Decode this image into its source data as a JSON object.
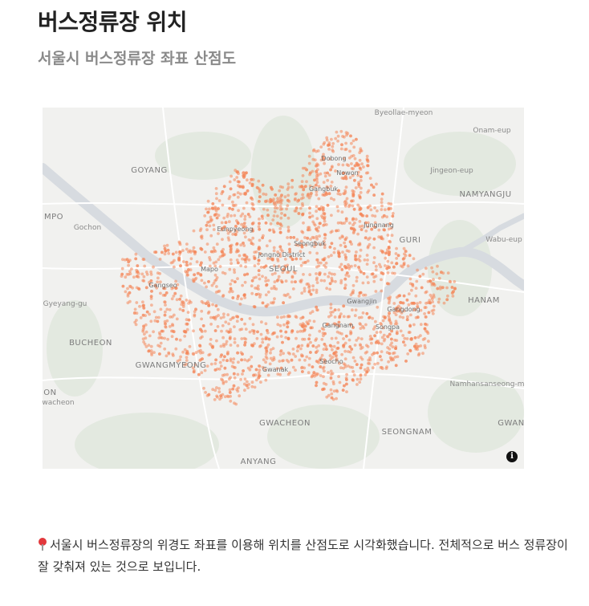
{
  "page": {
    "title": "버스정류장 위치",
    "subtitle": "서울시 버스정류장 좌표 산점도",
    "note": "서울시 버스정류장의 위경도 좌표를 이용해 위치를 산점도로 시각화했습니다. 전체적으로 버스 정류장이 잘 갖춰져 있는 것으로 보입니다.",
    "note_icon": "round-pushpin-icon"
  },
  "map": {
    "point_color": "#f4875a",
    "river_color": "#d9dde2",
    "land_color": "#f1f1ef",
    "info_label": "i",
    "place_labels": [
      {
        "name": "Byeollae-myeon"
      },
      {
        "name": "Onam-eup"
      },
      {
        "name": "GOYANG"
      },
      {
        "name": "Jingeon-eup"
      },
      {
        "name": "NAMYANGJU"
      },
      {
        "name": "MPO"
      },
      {
        "name": "Gochon"
      },
      {
        "name": "GURI"
      },
      {
        "name": "Wabu-eup"
      },
      {
        "name": "Gyeyang-gu"
      },
      {
        "name": "HANAM"
      },
      {
        "name": "BUCHEON"
      },
      {
        "name": "GWANGMYEONG"
      },
      {
        "name": "Namhansanseong-myeon"
      },
      {
        "name": "EON"
      },
      {
        "name": "Gwacheon"
      },
      {
        "name": "GWACHEON"
      },
      {
        "name": "SEONGNAM"
      },
      {
        "name": "GWAN"
      },
      {
        "name": "ANYANG"
      },
      {
        "name": "SEOUL"
      },
      {
        "name": "Jongno District"
      },
      {
        "name": "Dobong"
      },
      {
        "name": "Nowon"
      },
      {
        "name": "Gangbuk"
      },
      {
        "name": "Jungnang"
      },
      {
        "name": "Seongbuk"
      },
      {
        "name": "Eunpyeong"
      },
      {
        "name": "Mapo"
      },
      {
        "name": "Gangseo"
      },
      {
        "name": "Gwanak"
      },
      {
        "name": "Seocho"
      },
      {
        "name": "Gangnam"
      },
      {
        "name": "Songpa"
      },
      {
        "name": "Gangdong"
      },
      {
        "name": "Gwangjin"
      }
    ]
  }
}
